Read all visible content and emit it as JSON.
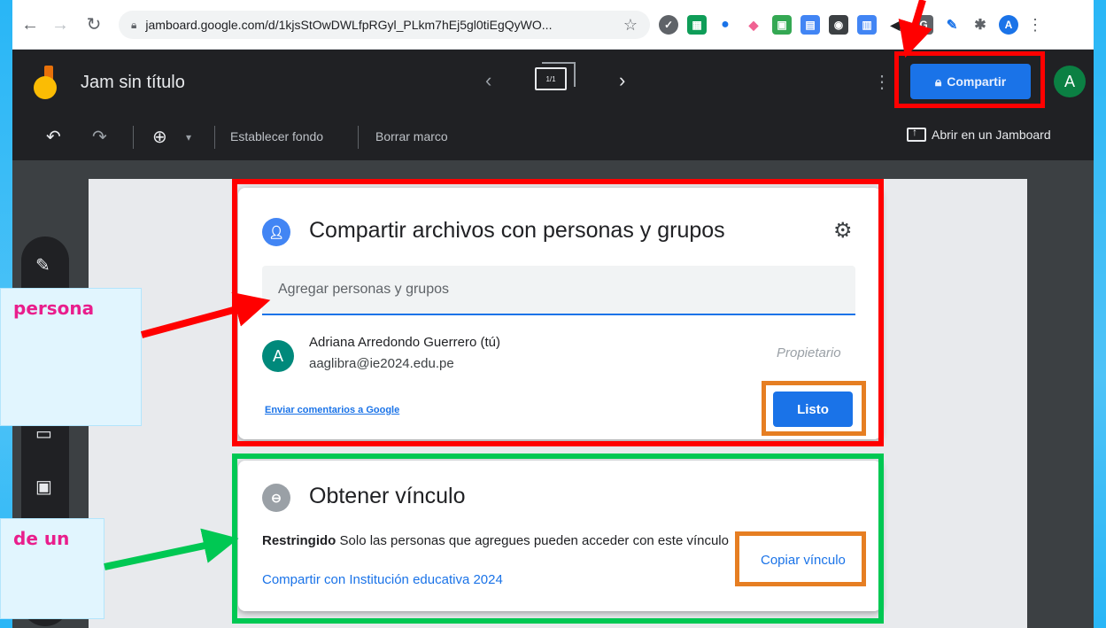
{
  "browser": {
    "url": "jamboard.google.com/d/1kjsStOwDWLfpRGyl_PLkm7hEj5gl0tiEgQyWO...",
    "profile_initial": "A"
  },
  "jamboard": {
    "title": "Jam sin título",
    "frame_counter": "1/1",
    "share_label": "Compartir",
    "user_initial": "A",
    "toolbar": {
      "set_background": "Establecer fondo",
      "clear_frame": "Borrar marco",
      "open_in_jamboard": "Abrir en un Jamboard"
    }
  },
  "share_dialog": {
    "title": "Compartir archivos con personas y grupos",
    "add_placeholder": "Agregar personas y grupos",
    "owner": {
      "initial": "A",
      "name": "Adriana Arredondo Guerrero (tú)",
      "email": "aaglibra@ie2024.edu.pe",
      "role": "Propietario"
    },
    "feedback_link": "Enviar comentarios a Google",
    "done_label": "Listo"
  },
  "link_dialog": {
    "title": "Obtener vínculo",
    "restricted_label": "Restringido",
    "restricted_desc": "Solo las personas que agregues pueden acceder con este vínculo",
    "share_org": "Compartir con Institución educativa 2024",
    "copy_link": "Copiar vínculo"
  },
  "annotations": {
    "callout_1": "persona",
    "callout_2": "de un"
  },
  "colors": {
    "accent_blue": "#1a73e8",
    "annotation_red": "#ff0000",
    "annotation_green": "#00c853",
    "annotation_orange": "#e67e22",
    "callout_text": "#e91e8c"
  }
}
